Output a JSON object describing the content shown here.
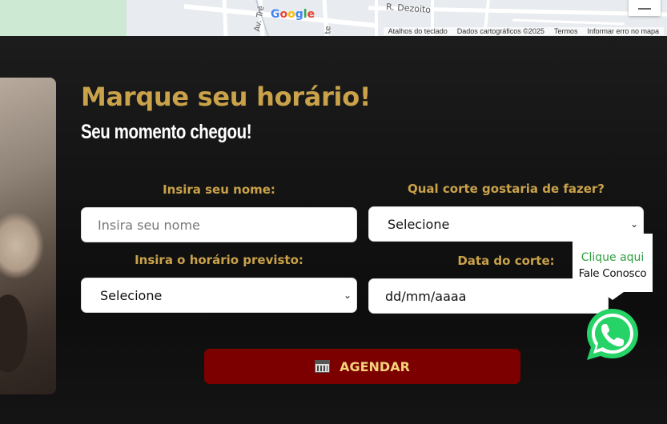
{
  "map": {
    "street1": "R. Dezoito",
    "street2": "Av. Tré",
    "street3": "te",
    "google_logo": "Google",
    "attribution": [
      "Atalhos do teclado",
      "Dados cartográficos ©2025",
      "Termos",
      "Informar erro no mapa"
    ]
  },
  "booking": {
    "title": "Marque seu horário!",
    "subtitle": "Seu momento chegou!",
    "name_label": "Insira seu nome:",
    "name_placeholder": "Insira seu nome",
    "cut_label": "Qual corte gostaria de fazer?",
    "cut_selected": "Selecione",
    "time_label": "Insira o horário previsto:",
    "time_selected": "Selecione",
    "date_label": "Data do corte:",
    "date_placeholder": "dd/mm/aaaa",
    "submit_label": "AGENDAR",
    "accent_color": "#c9a24a",
    "button_color": "#7d0000"
  },
  "whatsapp": {
    "tooltip_line1": "Clique aqui",
    "tooltip_line2": "Fale Conosco",
    "color": "#25d366"
  }
}
